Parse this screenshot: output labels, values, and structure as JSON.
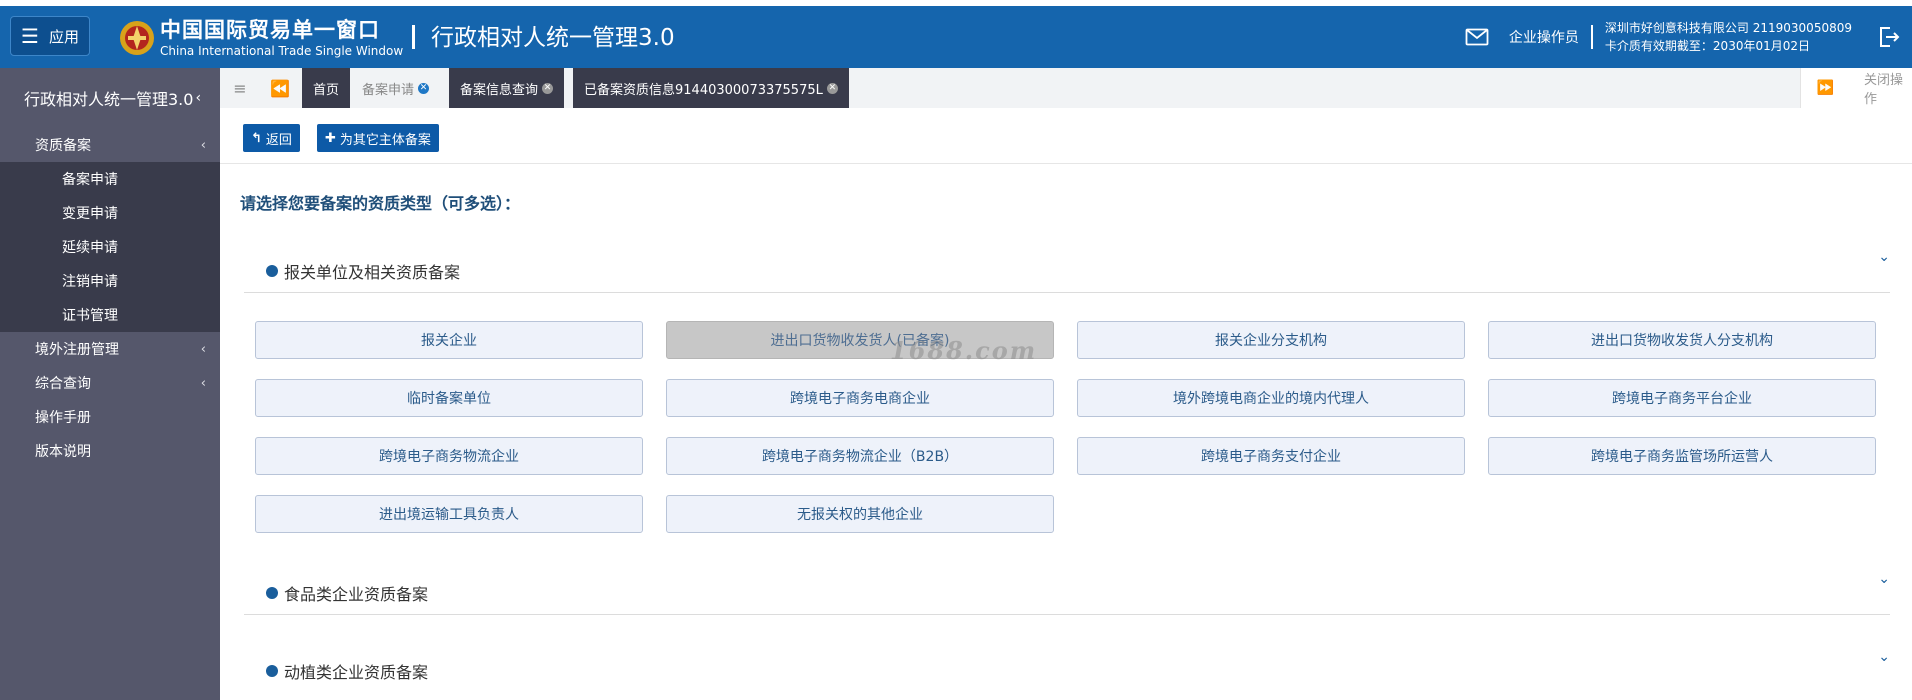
{
  "header": {
    "app_button_label": "应用",
    "brand_cn": "中国国际贸易单一窗口",
    "brand_en": "China International Trade Single Window",
    "system_title": "行政相对人统一管理3.0",
    "role": "企业操作员",
    "company_line1": "深圳市好创意科技有限公司 2119030050809",
    "company_line2": "卡介质有效期截至：2030年01月02日",
    "colors": {
      "header_bg": "#1565ad",
      "sidebar_bg": "#55576b",
      "sidebar_sub_bg": "#393b4b",
      "primary_button": "#0d5aa7"
    }
  },
  "sidebar": {
    "title": "行政相对人统一管理3.0",
    "items": [
      {
        "label": "资质备案",
        "expanded": true,
        "children": [
          "备案申请",
          "变更申请",
          "延续申请",
          "注销申请",
          "证书管理"
        ]
      },
      {
        "label": "境外注册管理"
      },
      {
        "label": "综合查询"
      },
      {
        "label": "操作手册"
      },
      {
        "label": "版本说明"
      }
    ]
  },
  "tabs": {
    "items": [
      {
        "label": "首页"
      },
      {
        "label": "备案申请",
        "active": true
      },
      {
        "label": "备案信息查询"
      },
      {
        "label": "已备案资质信息91440300073375575L"
      }
    ],
    "close_ops_label": "关闭操作"
  },
  "toolbar": {
    "back_label": "返回",
    "other_entity_label": "为其它主体备案"
  },
  "main": {
    "prompt": "请选择您要备案的资质类型（可多选）：",
    "sections": [
      {
        "title": "报关单位及相关资质备案"
      },
      {
        "title": "食品类企业资质备案"
      },
      {
        "title": "动植类企业资质备案"
      }
    ],
    "qualification_types": [
      {
        "label": "报关企业"
      },
      {
        "label": "进出口货物收发货人(已备案)",
        "disabled": true
      },
      {
        "label": "报关企业分支机构"
      },
      {
        "label": "进出口货物收发货人分支机构"
      },
      {
        "label": "临时备案单位"
      },
      {
        "label": "跨境电子商务电商企业"
      },
      {
        "label": "境外跨境电商企业的境内代理人"
      },
      {
        "label": "跨境电子商务平台企业"
      },
      {
        "label": "跨境电子商务物流企业"
      },
      {
        "label": "跨境电子商务物流企业（B2B）"
      },
      {
        "label": "跨境电子商务支付企业"
      },
      {
        "label": "跨境电子商务监管场所运营人"
      },
      {
        "label": "进出境运输工具负责人"
      },
      {
        "label": "无报关权的其他企业"
      }
    ],
    "watermark": "1688.com"
  }
}
